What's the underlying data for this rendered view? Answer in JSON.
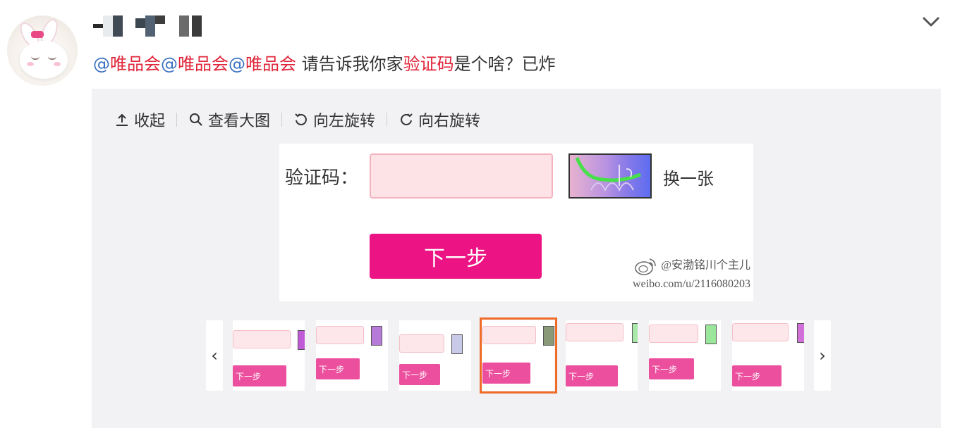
{
  "post": {
    "text_mention_1_at": "@",
    "text_mention_1_brand": "唯品会",
    "text_mention_2_at": "@",
    "text_mention_2_brand": "唯品会",
    "text_mention_3_at": "@",
    "text_mention_3_brand": "唯品会",
    "text_part_1": " 请告诉我你家",
    "text_highlight": "验证码",
    "text_part_2": "是个啥？已炸"
  },
  "toolbar": {
    "collapse_label": "收起",
    "view_large_label": "查看大图",
    "rotate_left_label": "向左旋转",
    "rotate_right_label": "向右旋转"
  },
  "image": {
    "captcha_label": "验证码：",
    "refresh_label": "换一张",
    "next_label": "下一步",
    "watermark_handle": "@安渤铭川个主儿",
    "watermark_url": "weibo.com/u/2116080203"
  },
  "thumbnails": {
    "prev_label": "‹",
    "next_label": "›",
    "button_label": "下一步",
    "items": [
      {
        "cap_color": "#c05ad6"
      },
      {
        "cap_color": "#b77ad9"
      },
      {
        "cap_color": "#c9c9e8"
      },
      {
        "cap_color": "#8a9a78"
      },
      {
        "cap_color": "#a8e8a8"
      },
      {
        "cap_color": "#9ae69a"
      },
      {
        "cap_color": "#d070d8"
      }
    ],
    "active_index": 3
  },
  "colors": {
    "mention": "#3a6fbf",
    "brand_red": "#e0263a",
    "button_pink": "#ec1384",
    "active_outline": "#ef6b27"
  }
}
